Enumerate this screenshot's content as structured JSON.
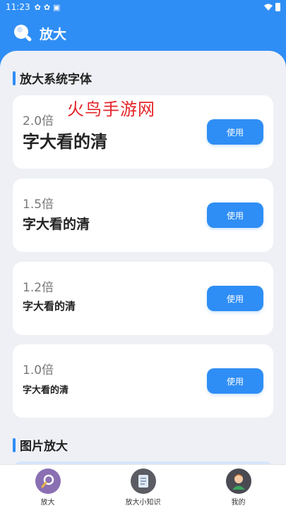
{
  "status_bar": {
    "time": "11:23",
    "icons": [
      "sync-icon",
      "sync-icon",
      "text-icon"
    ],
    "right_icons": [
      "wifi-icon",
      "battery-icon"
    ]
  },
  "header": {
    "title": "放大",
    "logo_icon": "magnifier-logo-icon"
  },
  "watermark": "火鸟手游网",
  "sections": {
    "font_title": "放大系统字体",
    "image_title": "图片放大"
  },
  "cards": [
    {
      "factor": "2.0倍",
      "sample": "字大看的清",
      "button": "使用"
    },
    {
      "factor": "1.5倍",
      "sample": "字大看的清",
      "button": "使用"
    },
    {
      "factor": "1.2倍",
      "sample": "字大看的清",
      "button": "使用"
    },
    {
      "factor": "1.0倍",
      "sample": "字大看的清",
      "button": "使用"
    }
  ],
  "bottom_nav": [
    {
      "label": "放大",
      "icon": "magnifier-icon",
      "active": true
    },
    {
      "label": "放大小知识",
      "icon": "notebook-icon",
      "active": false
    },
    {
      "label": "我的",
      "icon": "user-avatar-icon",
      "active": false
    }
  ],
  "colors": {
    "primary": "#2f8ef5",
    "background": "#eef0f5",
    "watermark": "#e5252a"
  }
}
